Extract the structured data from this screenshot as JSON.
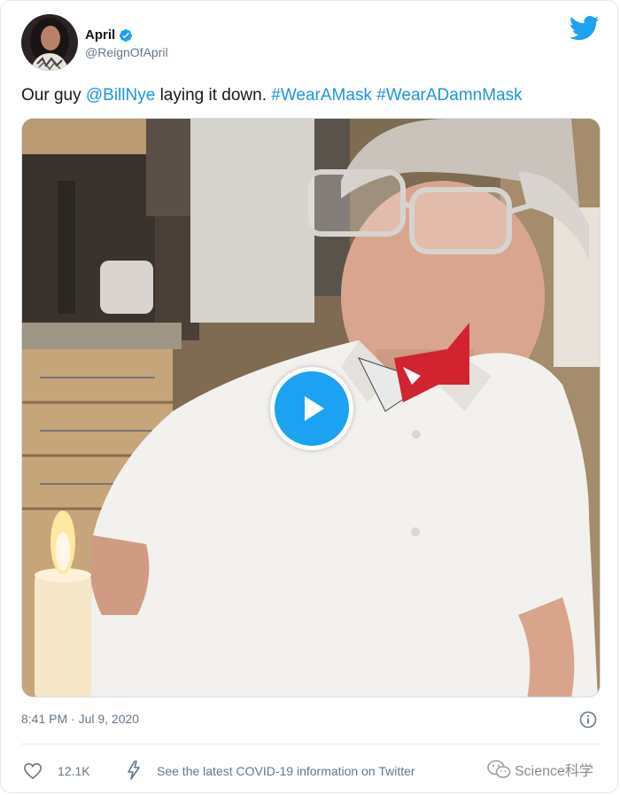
{
  "author": {
    "name": "April",
    "handle": "@ReignOfApril",
    "verified": true
  },
  "tweet": {
    "text_prefix": "Our guy ",
    "mention": "@BillNye",
    "text_middle": " laying it down. ",
    "hashtag_1": "#WearAMask",
    "text_space": " ",
    "hashtag_2": "#WearADamnMask"
  },
  "media": {
    "type": "video",
    "play_icon": "play-icon"
  },
  "meta": {
    "timestamp": "8:41 PM · Jul 9, 2020"
  },
  "actions": {
    "like_count": "12.1K",
    "covid_info": "See the latest COVID-19 information on Twitter"
  },
  "watermark": {
    "text": "Science科学"
  },
  "colors": {
    "link": "#1b95e0",
    "twitter_blue": "#1da1f2",
    "secondary_text": "#657786"
  }
}
